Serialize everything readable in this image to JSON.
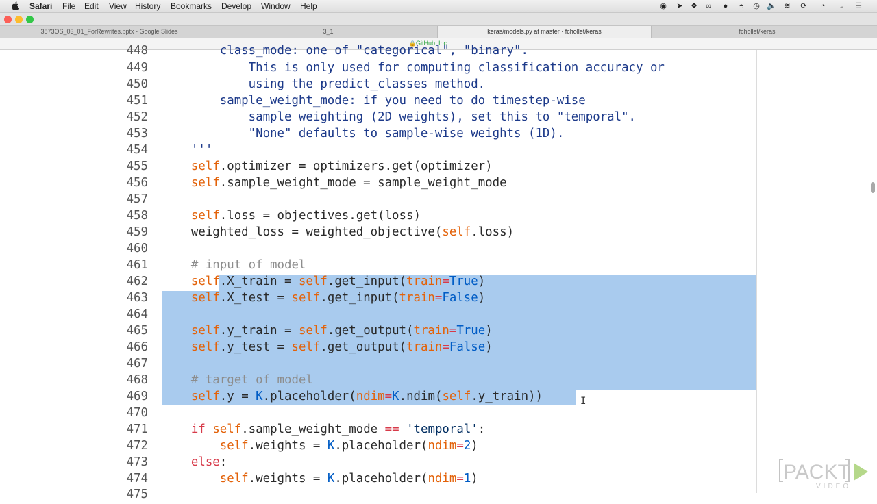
{
  "menubar": {
    "app_name": "Safari",
    "items": [
      "File",
      "Edit",
      "View",
      "History",
      "Bookmarks",
      "Develop",
      "Window",
      "Help"
    ]
  },
  "status_icons": [
    "record-icon",
    "location-icon",
    "dropbox-icon",
    "glasses-icon",
    "cloud-icon",
    "account-icon",
    "time-machine-icon",
    "volume-icon",
    "wifi-icon",
    "sync-icon",
    "search-icon",
    "list-icon"
  ],
  "tabs": [
    {
      "label": "3873OS_03_01_ForRewrites.pptx - Google Slides",
      "active": false
    },
    {
      "label": "3_1",
      "active": false
    },
    {
      "label": "keras/models.py at master · fchollet/keras",
      "active": true
    },
    {
      "label": "fchollet/keras",
      "active": false
    }
  ],
  "address": {
    "text": "GitHub, Inc."
  },
  "code_lines": [
    {
      "num": "449",
      "tokens": [
        {
          "t": "            This is only used for computing classification accuracy or",
          "c": "doc"
        }
      ]
    },
    {
      "num": "450",
      "tokens": [
        {
          "t": "            using the predict_classes method.",
          "c": "doc"
        }
      ]
    },
    {
      "num": "451",
      "tokens": [
        {
          "t": "        sample_weight_mode: if you need to do timestep-wise",
          "c": "doc"
        }
      ]
    },
    {
      "num": "452",
      "tokens": [
        {
          "t": "            sample weighting (2D weights), set this to \"temporal\".",
          "c": "doc"
        }
      ]
    },
    {
      "num": "453",
      "tokens": [
        {
          "t": "            \"None\" defaults to sample-wise weights (1D).",
          "c": "doc"
        }
      ]
    },
    {
      "num": "454",
      "tokens": [
        {
          "t": "    '''",
          "c": "doc"
        }
      ]
    },
    {
      "num": "455",
      "tokens": [
        {
          "t": "    ",
          "c": ""
        },
        {
          "t": "self",
          "c": "self"
        },
        {
          "t": ".optimizer = optimizers.get(optimizer)",
          "c": ""
        }
      ]
    },
    {
      "num": "456",
      "tokens": [
        {
          "t": "    ",
          "c": ""
        },
        {
          "t": "self",
          "c": "self"
        },
        {
          "t": ".sample_weight_mode = sample_weight_mode",
          "c": ""
        }
      ]
    },
    {
      "num": "457",
      "tokens": []
    },
    {
      "num": "458",
      "tokens": [
        {
          "t": "    ",
          "c": ""
        },
        {
          "t": "self",
          "c": "self"
        },
        {
          "t": ".loss = objectives.get(loss)",
          "c": ""
        }
      ]
    },
    {
      "num": "459",
      "tokens": [
        {
          "t": "    weighted_loss = weighted_objective(",
          "c": ""
        },
        {
          "t": "self",
          "c": "self"
        },
        {
          "t": ".loss)",
          "c": ""
        }
      ]
    },
    {
      "num": "460",
      "tokens": []
    },
    {
      "num": "461",
      "tokens": [
        {
          "t": "    # input of model",
          "c": "cm"
        }
      ]
    },
    {
      "num": "462",
      "tokens": [
        {
          "t": "    ",
          "c": ""
        },
        {
          "t": "self",
          "c": "self"
        },
        {
          "t": ".X_train = ",
          "c": ""
        },
        {
          "t": "self",
          "c": "self"
        },
        {
          "t": ".get_input(",
          "c": ""
        },
        {
          "t": "train",
          "c": "param"
        },
        {
          "t": "=",
          "c": "kw"
        },
        {
          "t": "True",
          "c": "const"
        },
        {
          "t": ")",
          "c": ""
        }
      ]
    },
    {
      "num": "463",
      "tokens": [
        {
          "t": "    ",
          "c": ""
        },
        {
          "t": "self",
          "c": "self"
        },
        {
          "t": ".X_test = ",
          "c": ""
        },
        {
          "t": "self",
          "c": "self"
        },
        {
          "t": ".get_input(",
          "c": ""
        },
        {
          "t": "train",
          "c": "param"
        },
        {
          "t": "=",
          "c": "kw"
        },
        {
          "t": "False",
          "c": "const"
        },
        {
          "t": ")",
          "c": ""
        }
      ]
    },
    {
      "num": "464",
      "tokens": []
    },
    {
      "num": "465",
      "tokens": [
        {
          "t": "    ",
          "c": ""
        },
        {
          "t": "self",
          "c": "self"
        },
        {
          "t": ".y_train = ",
          "c": ""
        },
        {
          "t": "self",
          "c": "self"
        },
        {
          "t": ".get_output(",
          "c": ""
        },
        {
          "t": "train",
          "c": "param"
        },
        {
          "t": "=",
          "c": "kw"
        },
        {
          "t": "True",
          "c": "const"
        },
        {
          "t": ")",
          "c": ""
        }
      ]
    },
    {
      "num": "466",
      "tokens": [
        {
          "t": "    ",
          "c": ""
        },
        {
          "t": "self",
          "c": "self"
        },
        {
          "t": ".y_test = ",
          "c": ""
        },
        {
          "t": "self",
          "c": "self"
        },
        {
          "t": ".get_output(",
          "c": ""
        },
        {
          "t": "train",
          "c": "param"
        },
        {
          "t": "=",
          "c": "kw"
        },
        {
          "t": "False",
          "c": "const"
        },
        {
          "t": ")",
          "c": ""
        }
      ]
    },
    {
      "num": "467",
      "tokens": []
    },
    {
      "num": "468",
      "tokens": [
        {
          "t": "    # target of model",
          "c": "cm"
        }
      ]
    },
    {
      "num": "469",
      "tokens": [
        {
          "t": "    ",
          "c": ""
        },
        {
          "t": "self",
          "c": "self"
        },
        {
          "t": ".y = ",
          "c": ""
        },
        {
          "t": "K",
          "c": "K"
        },
        {
          "t": ".placeholder(",
          "c": ""
        },
        {
          "t": "ndim",
          "c": "param"
        },
        {
          "t": "=",
          "c": "kw"
        },
        {
          "t": "K",
          "c": "K"
        },
        {
          "t": ".ndim(",
          "c": ""
        },
        {
          "t": "self",
          "c": "self"
        },
        {
          "t": ".y_train))",
          "c": ""
        }
      ]
    },
    {
      "num": "470",
      "tokens": []
    },
    {
      "num": "471",
      "tokens": [
        {
          "t": "    ",
          "c": ""
        },
        {
          "t": "if",
          "c": "kw"
        },
        {
          "t": " ",
          "c": ""
        },
        {
          "t": "self",
          "c": "self"
        },
        {
          "t": ".sample_weight_mode ",
          "c": ""
        },
        {
          "t": "==",
          "c": "kw"
        },
        {
          "t": " ",
          "c": ""
        },
        {
          "t": "'temporal'",
          "c": "str"
        },
        {
          "t": ":",
          "c": ""
        }
      ]
    },
    {
      "num": "472",
      "tokens": [
        {
          "t": "        ",
          "c": ""
        },
        {
          "t": "self",
          "c": "self"
        },
        {
          "t": ".weights = ",
          "c": ""
        },
        {
          "t": "K",
          "c": "K"
        },
        {
          "t": ".placeholder(",
          "c": ""
        },
        {
          "t": "ndim",
          "c": "param"
        },
        {
          "t": "=",
          "c": "kw"
        },
        {
          "t": "2",
          "c": "const"
        },
        {
          "t": ")",
          "c": ""
        }
      ]
    },
    {
      "num": "473",
      "tokens": [
        {
          "t": "    ",
          "c": ""
        },
        {
          "t": "else",
          "c": "kw"
        },
        {
          "t": ":",
          "c": ""
        }
      ]
    },
    {
      "num": "474",
      "tokens": [
        {
          "t": "        ",
          "c": ""
        },
        {
          "t": "self",
          "c": "self"
        },
        {
          "t": ".weights = ",
          "c": ""
        },
        {
          "t": "K",
          "c": "K"
        },
        {
          "t": ".placeholder(",
          "c": ""
        },
        {
          "t": "ndim",
          "c": "param"
        },
        {
          "t": "=",
          "c": "kw"
        },
        {
          "t": "1",
          "c": "const"
        },
        {
          "t": ")",
          "c": ""
        }
      ]
    }
  ],
  "partial_lines": {
    "top": {
      "num": "448",
      "text": "        class_mode: one of \"categorical\", \"binary\"."
    },
    "bottom": {
      "num": "475"
    }
  },
  "watermark": {
    "brand": "PACKT",
    "sub": "VIDEO"
  }
}
